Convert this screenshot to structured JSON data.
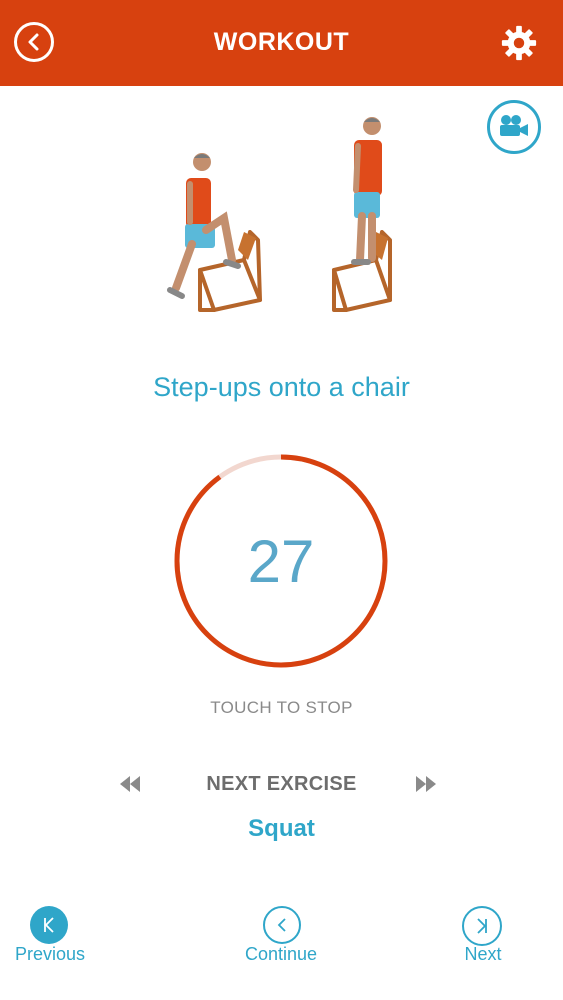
{
  "header": {
    "title": "WORKOUT",
    "back_icon": "chevron-left-icon",
    "settings_icon": "gear-icon",
    "color": "#d7410f"
  },
  "exercise": {
    "name": "Step-ups onto a chair",
    "video_icon": "video-camera-icon"
  },
  "timer": {
    "value": "27",
    "progress_fraction": 0.1,
    "track_color": "#f2d7cf",
    "fill_color": "#d7410f"
  },
  "touch_to_stop": "TOUCH TO STOP",
  "next_exercise": {
    "label": "NEXT EXRCISE",
    "name": "Squat",
    "prev_icon": "rewind-icon",
    "next_icon": "fast-forward-icon"
  },
  "bottom_nav": {
    "previous": "Previous",
    "continue": "Continue",
    "next": "Next"
  },
  "colors": {
    "accent": "#2fa6c9",
    "muted": "#8a8a8a"
  }
}
